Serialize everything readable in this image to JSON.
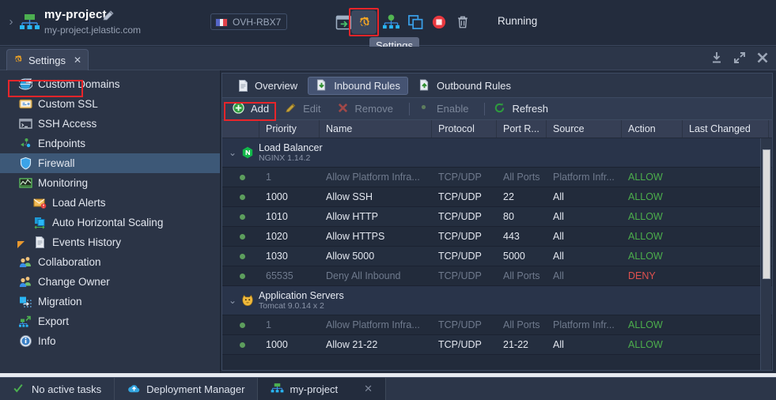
{
  "topbar": {
    "env_name": "my-project",
    "env_domain": "my-project.jelastic.com",
    "region": "OVH-RBX7",
    "status": "Running",
    "tooltip": "Settings",
    "icons": {
      "chevron": "›",
      "open_in_browser": "open-in-browser-icon",
      "settings": "settings-gear-icon",
      "topology": "change-topology-icon",
      "clone": "clone-environment-icon",
      "stop": "stop-environment-icon",
      "delete": "delete-environment-icon"
    }
  },
  "tabstrip": {
    "tab_label": "Settings",
    "close_glyph": "✕"
  },
  "sidebar": {
    "items": [
      {
        "label": "Custom Domains",
        "icon": "globe-icon",
        "sub": false,
        "selected": false
      },
      {
        "label": "Custom SSL",
        "icon": "certificate-icon",
        "sub": false,
        "selected": false
      },
      {
        "label": "SSH Access",
        "icon": "terminal-icon",
        "sub": false,
        "selected": false
      },
      {
        "label": "Endpoints",
        "icon": "endpoints-icon",
        "sub": false,
        "selected": false
      },
      {
        "label": "Firewall",
        "icon": "shield-icon",
        "sub": false,
        "selected": true
      },
      {
        "label": "Monitoring",
        "icon": "monitoring-icon",
        "sub": false,
        "selected": false
      },
      {
        "label": "Load Alerts",
        "icon": "envelope-alert-icon",
        "sub": true,
        "selected": false
      },
      {
        "label": "Auto Horizontal Scaling",
        "icon": "scaling-icon",
        "sub": true,
        "selected": false
      },
      {
        "label": "Events History",
        "icon": "document-icon",
        "sub": true,
        "selected": false
      },
      {
        "label": "Collaboration",
        "icon": "users-icon",
        "sub": false,
        "selected": false
      },
      {
        "label": "Change Owner",
        "icon": "change-owner-icon",
        "sub": false,
        "selected": false
      },
      {
        "label": "Migration",
        "icon": "migration-icon",
        "sub": false,
        "selected": false
      },
      {
        "label": "Export",
        "icon": "export-icon",
        "sub": false,
        "selected": false
      },
      {
        "label": "Info",
        "icon": "info-icon",
        "sub": false,
        "selected": false
      }
    ]
  },
  "main": {
    "subtabs": [
      {
        "label": "Overview",
        "icon": "document-icon",
        "active": false
      },
      {
        "label": "Inbound Rules",
        "icon": "inbound-icon",
        "active": true
      },
      {
        "label": "Outbound Rules",
        "icon": "outbound-icon",
        "active": false
      }
    ],
    "toolbar": [
      {
        "label": "Add",
        "icon": "add-icon",
        "enabled": true
      },
      {
        "label": "Edit",
        "icon": "edit-icon",
        "enabled": false
      },
      {
        "label": "Remove",
        "icon": "remove-icon",
        "enabled": false
      },
      {
        "label": "Enable",
        "icon": "enable-icon",
        "enabled": false
      },
      {
        "label": "Refresh",
        "icon": "refresh-icon",
        "enabled": true
      }
    ],
    "columns": [
      "",
      "Priority",
      "Name",
      "Protocol",
      "Port R...",
      "Source",
      "Action",
      "Last Changed"
    ],
    "groups": [
      {
        "title": "Load Balancer",
        "subtitle": "NGINX 1.14.2",
        "icon": "nginx-icon",
        "rows": [
          {
            "priority": "1",
            "name": "Allow Platform Infra...",
            "protocol": "TCP/UDP",
            "port": "All Ports",
            "source": "Platform Infr...",
            "action": "ALLOW",
            "changed": "",
            "dim": true
          },
          {
            "priority": "1000",
            "name": "Allow SSH",
            "protocol": "TCP/UDP",
            "port": "22",
            "source": "All",
            "action": "ALLOW",
            "changed": "",
            "dim": false
          },
          {
            "priority": "1010",
            "name": "Allow HTTP",
            "protocol": "TCP/UDP",
            "port": "80",
            "source": "All",
            "action": "ALLOW",
            "changed": "",
            "dim": false
          },
          {
            "priority": "1020",
            "name": "Allow HTTPS",
            "protocol": "TCP/UDP",
            "port": "443",
            "source": "All",
            "action": "ALLOW",
            "changed": "",
            "dim": false
          },
          {
            "priority": "1030",
            "name": "Allow 5000",
            "protocol": "TCP/UDP",
            "port": "5000",
            "source": "All",
            "action": "ALLOW",
            "changed": "",
            "dim": false
          },
          {
            "priority": "65535",
            "name": "Deny All Inbound",
            "protocol": "TCP/UDP",
            "port": "All Ports",
            "source": "All",
            "action": "DENY",
            "changed": "",
            "dim": true
          }
        ]
      },
      {
        "title": "Application Servers",
        "subtitle": "Tomcat 9.0.14 x 2",
        "icon": "tomcat-icon",
        "rows": [
          {
            "priority": "1",
            "name": "Allow Platform Infra...",
            "protocol": "TCP/UDP",
            "port": "All Ports",
            "source": "Platform Infr...",
            "action": "ALLOW",
            "changed": "",
            "dim": true
          },
          {
            "priority": "1000",
            "name": "Allow 21-22",
            "protocol": "TCP/UDP",
            "port": "21-22",
            "source": "All",
            "action": "ALLOW",
            "changed": "",
            "dim": false
          }
        ]
      }
    ]
  },
  "bottombar": {
    "items": [
      {
        "label": "No active tasks",
        "icon": "check-icon",
        "active": false,
        "closable": false
      },
      {
        "label": "Deployment Manager",
        "icon": "cloud-icon",
        "active": false,
        "closable": false
      },
      {
        "label": "my-project",
        "icon": "environment-icon",
        "active": true,
        "closable": true
      }
    ],
    "close_glyph": "✕"
  },
  "colors": {
    "accent_red": "#e8252a",
    "allow_green": "#4cae4c",
    "deny_red": "#e0514f",
    "selected_blue": "#3d5877"
  }
}
